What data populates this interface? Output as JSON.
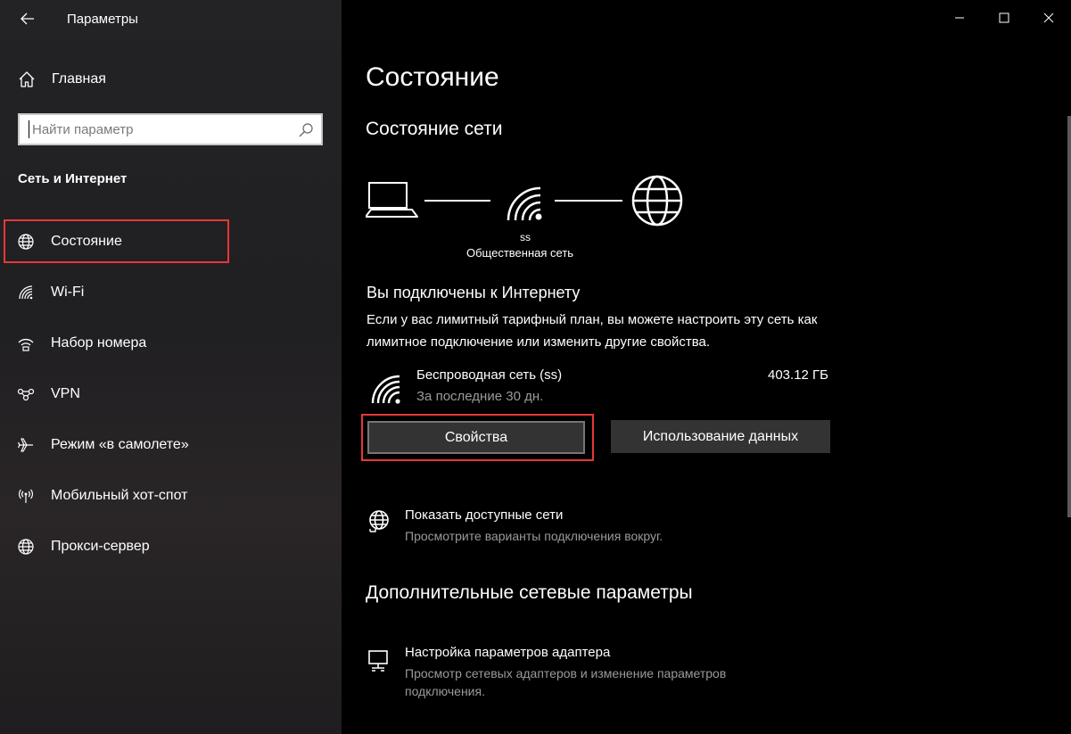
{
  "window": {
    "title": "Параметры",
    "controls": [
      "minimize-icon",
      "maximize-icon",
      "close-icon"
    ]
  },
  "sidebar": {
    "home_label": "Главная",
    "search_placeholder": "Найти параметр",
    "section_title": "Сеть и Интернет",
    "items": [
      {
        "label": "Состояние",
        "icon": "globe-icon",
        "active": true
      },
      {
        "label": "Wi-Fi",
        "icon": "wifi-icon"
      },
      {
        "label": "Набор номера",
        "icon": "dialup-icon"
      },
      {
        "label": "VPN",
        "icon": "vpn-icon"
      },
      {
        "label": "Режим «в самолете»",
        "icon": "airplane-icon"
      },
      {
        "label": "Мобильный хот-спот",
        "icon": "hotspot-icon"
      },
      {
        "label": "Прокси-сервер",
        "icon": "globe-icon"
      }
    ]
  },
  "main": {
    "title": "Состояние",
    "network_status_title": "Состояние сети",
    "network": {
      "name": "ss",
      "type": "Общественная сеть"
    },
    "connected_title": "Вы подключены к Интернету",
    "connected_desc": "Если у вас лимитный тарифный план, вы можете настроить эту сеть как лимитное подключение или изменить другие свойства.",
    "adapter": {
      "name": "Беспроводная сеть (ss)",
      "period": "За последние 30 дн.",
      "usage": "403.12 ГБ"
    },
    "buttons": {
      "properties": "Свойства",
      "data_usage": "Использование данных"
    },
    "show_networks": {
      "title": "Показать доступные сети",
      "desc": "Просмотрите варианты подключения вокруг."
    },
    "advanced_title": "Дополнительные сетевые параметры",
    "adapter_settings": {
      "title": "Настройка параметров адаптера",
      "desc_line1": "Просмотр сетевых адаптеров и изменение параметров",
      "desc_line2": "подключения."
    }
  },
  "colors": {
    "highlight_box": "#e53935",
    "button_bg": "#333333",
    "secondary_text": "#9a9a9a"
  }
}
